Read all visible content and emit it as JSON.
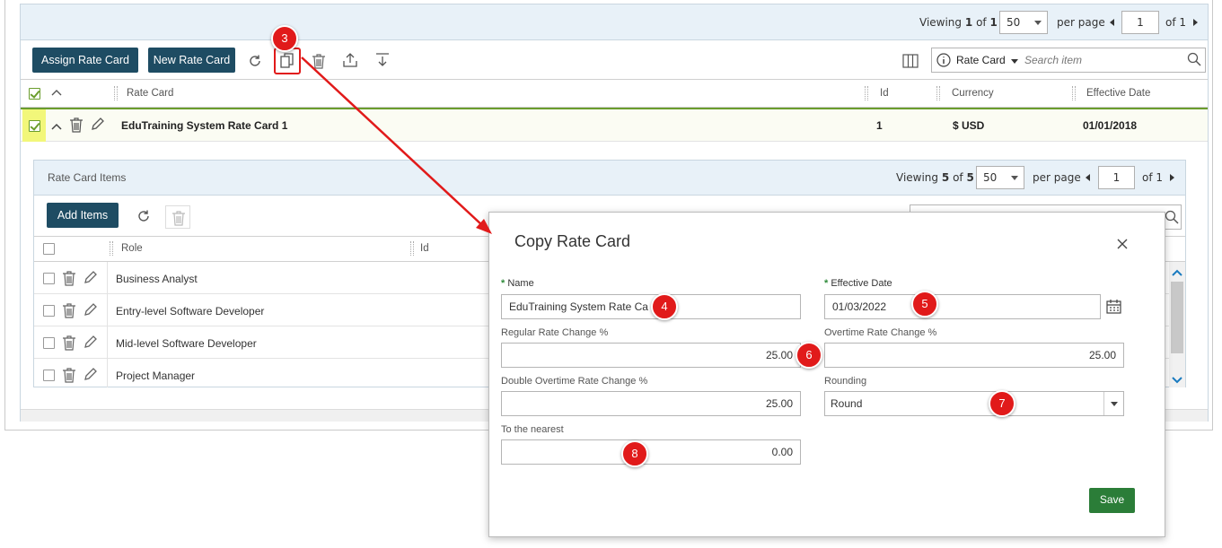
{
  "rate_cards": {
    "viewing_prefix": "Viewing",
    "viewing_current": "1",
    "viewing_of": "of",
    "viewing_total": "1",
    "page_size": "50",
    "per_page_label": "per page",
    "page_number": "1",
    "page_of": "of 1",
    "assign_button": "Assign Rate Card",
    "new_button": "New Rate Card",
    "search_field_label": "Rate Card",
    "search_placeholder": "Search item",
    "columns": [
      "Rate Card",
      "Id",
      "Currency",
      "Effective Date"
    ],
    "row": {
      "name": "EduTraining System Rate Card 1",
      "id": "1",
      "currency": "$ USD",
      "effective_date": "01/01/2018"
    }
  },
  "items": {
    "title": "Rate Card Items",
    "viewing_prefix": "Viewing",
    "viewing_current": "5",
    "viewing_of": "of",
    "viewing_total": "5",
    "page_size": "50",
    "per_page_label": "per page",
    "page_number": "1",
    "page_of": "of 1",
    "add_button": "Add Items",
    "columns": [
      "Role",
      "Id"
    ],
    "rows": [
      "Business Analyst",
      "Entry-level Software Developer",
      "Mid-level Software Developer",
      "Project Manager"
    ]
  },
  "modal": {
    "title": "Copy Rate Card",
    "name_label": "Name",
    "name_value": "EduTraining System Rate Ca",
    "effective_date_label": "Effective Date",
    "effective_date_value": "01/03/2022",
    "regular_label": "Regular Rate Change %",
    "regular_value": "25.00",
    "overtime_label": "Overtime Rate Change %",
    "overtime_value": "25.00",
    "double_label": "Double Overtime Rate Change %",
    "double_value": "25.00",
    "rounding_label": "Rounding",
    "rounding_value": "Round",
    "nearest_label": "To the nearest",
    "nearest_value": "0.00",
    "save_button": "Save"
  },
  "annotations": {
    "b3": "3",
    "b4": "4",
    "b5": "5",
    "b6": "6",
    "b7": "7",
    "b8": "8",
    "color": "#e11a1a"
  }
}
